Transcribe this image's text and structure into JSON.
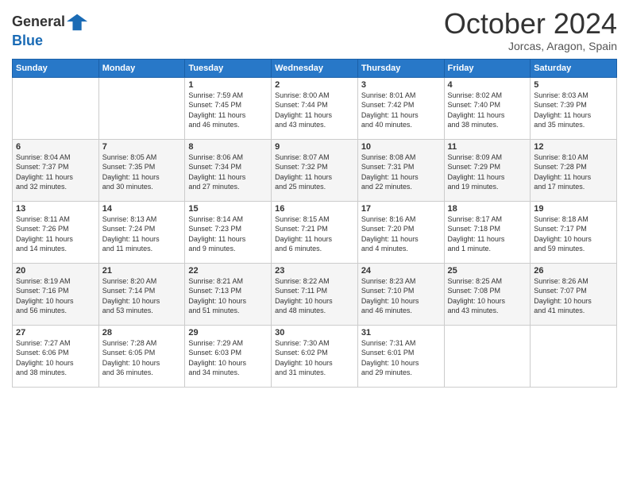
{
  "logo": {
    "line1": "General",
    "line2": "Blue"
  },
  "title": "October 2024",
  "location": "Jorcas, Aragon, Spain",
  "days_of_week": [
    "Sunday",
    "Monday",
    "Tuesday",
    "Wednesday",
    "Thursday",
    "Friday",
    "Saturday"
  ],
  "weeks": [
    [
      {
        "day": "",
        "info": ""
      },
      {
        "day": "",
        "info": ""
      },
      {
        "day": "1",
        "info": "Sunrise: 7:59 AM\nSunset: 7:45 PM\nDaylight: 11 hours\nand 46 minutes."
      },
      {
        "day": "2",
        "info": "Sunrise: 8:00 AM\nSunset: 7:44 PM\nDaylight: 11 hours\nand 43 minutes."
      },
      {
        "day": "3",
        "info": "Sunrise: 8:01 AM\nSunset: 7:42 PM\nDaylight: 11 hours\nand 40 minutes."
      },
      {
        "day": "4",
        "info": "Sunrise: 8:02 AM\nSunset: 7:40 PM\nDaylight: 11 hours\nand 38 minutes."
      },
      {
        "day": "5",
        "info": "Sunrise: 8:03 AM\nSunset: 7:39 PM\nDaylight: 11 hours\nand 35 minutes."
      }
    ],
    [
      {
        "day": "6",
        "info": "Sunrise: 8:04 AM\nSunset: 7:37 PM\nDaylight: 11 hours\nand 32 minutes."
      },
      {
        "day": "7",
        "info": "Sunrise: 8:05 AM\nSunset: 7:35 PM\nDaylight: 11 hours\nand 30 minutes."
      },
      {
        "day": "8",
        "info": "Sunrise: 8:06 AM\nSunset: 7:34 PM\nDaylight: 11 hours\nand 27 minutes."
      },
      {
        "day": "9",
        "info": "Sunrise: 8:07 AM\nSunset: 7:32 PM\nDaylight: 11 hours\nand 25 minutes."
      },
      {
        "day": "10",
        "info": "Sunrise: 8:08 AM\nSunset: 7:31 PM\nDaylight: 11 hours\nand 22 minutes."
      },
      {
        "day": "11",
        "info": "Sunrise: 8:09 AM\nSunset: 7:29 PM\nDaylight: 11 hours\nand 19 minutes."
      },
      {
        "day": "12",
        "info": "Sunrise: 8:10 AM\nSunset: 7:28 PM\nDaylight: 11 hours\nand 17 minutes."
      }
    ],
    [
      {
        "day": "13",
        "info": "Sunrise: 8:11 AM\nSunset: 7:26 PM\nDaylight: 11 hours\nand 14 minutes."
      },
      {
        "day": "14",
        "info": "Sunrise: 8:13 AM\nSunset: 7:24 PM\nDaylight: 11 hours\nand 11 minutes."
      },
      {
        "day": "15",
        "info": "Sunrise: 8:14 AM\nSunset: 7:23 PM\nDaylight: 11 hours\nand 9 minutes."
      },
      {
        "day": "16",
        "info": "Sunrise: 8:15 AM\nSunset: 7:21 PM\nDaylight: 11 hours\nand 6 minutes."
      },
      {
        "day": "17",
        "info": "Sunrise: 8:16 AM\nSunset: 7:20 PM\nDaylight: 11 hours\nand 4 minutes."
      },
      {
        "day": "18",
        "info": "Sunrise: 8:17 AM\nSunset: 7:18 PM\nDaylight: 11 hours\nand 1 minute."
      },
      {
        "day": "19",
        "info": "Sunrise: 8:18 AM\nSunset: 7:17 PM\nDaylight: 10 hours\nand 59 minutes."
      }
    ],
    [
      {
        "day": "20",
        "info": "Sunrise: 8:19 AM\nSunset: 7:16 PM\nDaylight: 10 hours\nand 56 minutes."
      },
      {
        "day": "21",
        "info": "Sunrise: 8:20 AM\nSunset: 7:14 PM\nDaylight: 10 hours\nand 53 minutes."
      },
      {
        "day": "22",
        "info": "Sunrise: 8:21 AM\nSunset: 7:13 PM\nDaylight: 10 hours\nand 51 minutes."
      },
      {
        "day": "23",
        "info": "Sunrise: 8:22 AM\nSunset: 7:11 PM\nDaylight: 10 hours\nand 48 minutes."
      },
      {
        "day": "24",
        "info": "Sunrise: 8:23 AM\nSunset: 7:10 PM\nDaylight: 10 hours\nand 46 minutes."
      },
      {
        "day": "25",
        "info": "Sunrise: 8:25 AM\nSunset: 7:08 PM\nDaylight: 10 hours\nand 43 minutes."
      },
      {
        "day": "26",
        "info": "Sunrise: 8:26 AM\nSunset: 7:07 PM\nDaylight: 10 hours\nand 41 minutes."
      }
    ],
    [
      {
        "day": "27",
        "info": "Sunrise: 7:27 AM\nSunset: 6:06 PM\nDaylight: 10 hours\nand 38 minutes."
      },
      {
        "day": "28",
        "info": "Sunrise: 7:28 AM\nSunset: 6:05 PM\nDaylight: 10 hours\nand 36 minutes."
      },
      {
        "day": "29",
        "info": "Sunrise: 7:29 AM\nSunset: 6:03 PM\nDaylight: 10 hours\nand 34 minutes."
      },
      {
        "day": "30",
        "info": "Sunrise: 7:30 AM\nSunset: 6:02 PM\nDaylight: 10 hours\nand 31 minutes."
      },
      {
        "day": "31",
        "info": "Sunrise: 7:31 AM\nSunset: 6:01 PM\nDaylight: 10 hours\nand 29 minutes."
      },
      {
        "day": "",
        "info": ""
      },
      {
        "day": "",
        "info": ""
      }
    ]
  ]
}
